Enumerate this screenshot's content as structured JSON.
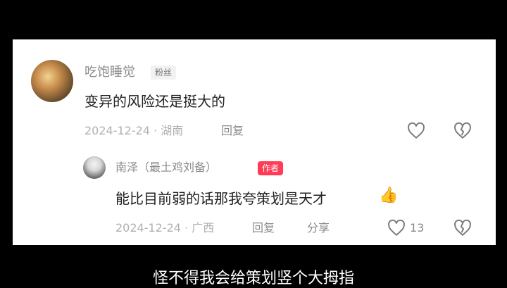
{
  "comment": {
    "username": "吃饱睡觉",
    "badge": "粉丝",
    "text": "变异的风险还是挺大的",
    "meta": "2024-12-24 · 湖南",
    "reply_label": "回复"
  },
  "reply": {
    "username": "南泽（最土鸡刘备）",
    "badge": "作者",
    "text": "能比目前弱的话那我夸策划是天才",
    "emoji": "👍",
    "meta": "2024-12-24 · 广西",
    "reply_label": "回复",
    "share_label": "分享",
    "like_count": "13"
  },
  "caption": {
    "text": "怪不得我会给策划竖个大拇指"
  },
  "icons": {
    "like": "heart-outline-icon",
    "dislike": "broken-heart-icon"
  },
  "colors": {
    "background": "#000000",
    "card": "#ffffff",
    "author_badge": "#ff3b55"
  }
}
